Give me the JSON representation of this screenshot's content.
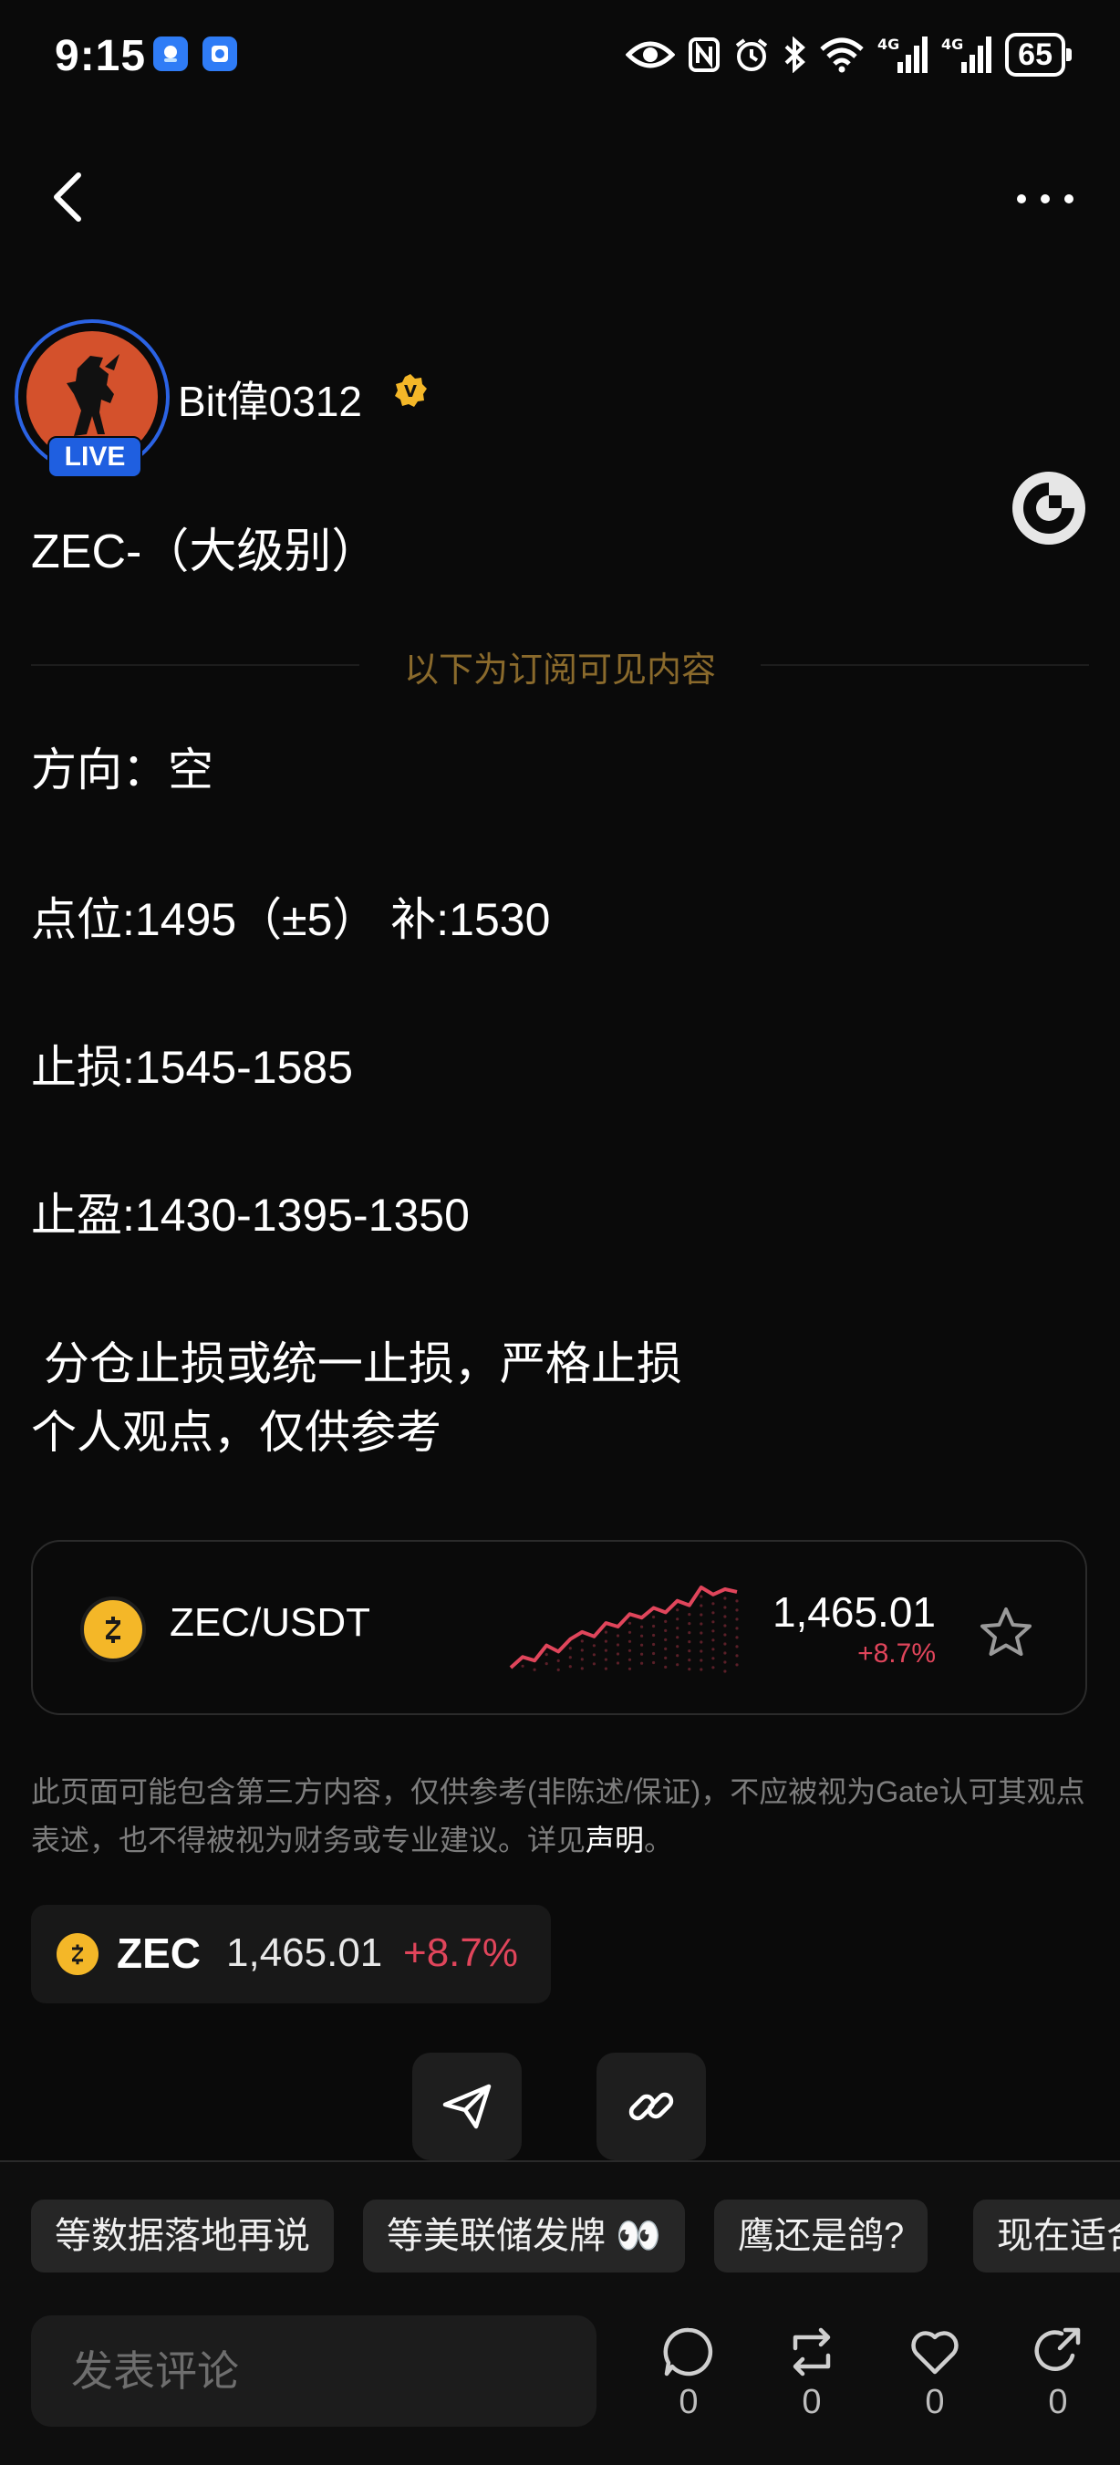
{
  "status_bar": {
    "time": "9:15",
    "battery": "65",
    "icons": [
      "eye-icon",
      "nfc-icon",
      "alarm-icon",
      "bluetooth-icon",
      "wifi-icon",
      "signal-4g-icon",
      "signal-4g-icon"
    ]
  },
  "header": {
    "back_icon": "chevron-left-icon",
    "more_icon": "more-dots-icon"
  },
  "author": {
    "name": "Bit偉0312",
    "live_label": "LIVE",
    "verified_badge": "V"
  },
  "post": {
    "title": "ZEC-（大级别）",
    "subscription_divider": "以下为订阅可见内容",
    "lines": [
      "方向：空",
      "点位:1495（±5） 补:1530",
      "止损:1545-1585",
      "止盈:1430-1395-1350",
      " 分仓止损或统一止损，严格止损",
      "个人观点，仅供参考"
    ]
  },
  "coin_card": {
    "pair": "ZEC/USDT",
    "price": "1,465.01",
    "change": "+8.7%",
    "sparkline": [
      1380,
      1392,
      1388,
      1405,
      1398,
      1412,
      1420,
      1415,
      1430,
      1426,
      1440,
      1436,
      1447,
      1442,
      1455,
      1450,
      1470,
      1462,
      1468,
      1465
    ]
  },
  "disclaimer": {
    "text": "此页面可能包含第三方内容，仅供参考(非陈述/保证)，不应被视为Gate认可其观点表述，也不得被视为财务或专业建议。详见",
    "link": "声明",
    "end": "。"
  },
  "ticker": {
    "symbol": "ZEC",
    "price": "1,465.01",
    "change": "+8.7%"
  },
  "quick_replies": [
    "等数据落地再说",
    "等美联储发牌 👀",
    "鹰还是鸽?",
    "现在适合"
  ],
  "comment": {
    "placeholder": "发表评论"
  },
  "actions": [
    {
      "icon": "comment-icon",
      "count": "0"
    },
    {
      "icon": "repost-icon",
      "count": "0"
    },
    {
      "icon": "like-icon",
      "count": "0"
    },
    {
      "icon": "share-icon",
      "count": "0"
    }
  ],
  "colors": {
    "background": "#0a0a0a",
    "negative": "#e0455b",
    "gold": "#8a6a2c",
    "live_blue": "#1f5fe0",
    "zec_yellow": "#f4b728"
  }
}
